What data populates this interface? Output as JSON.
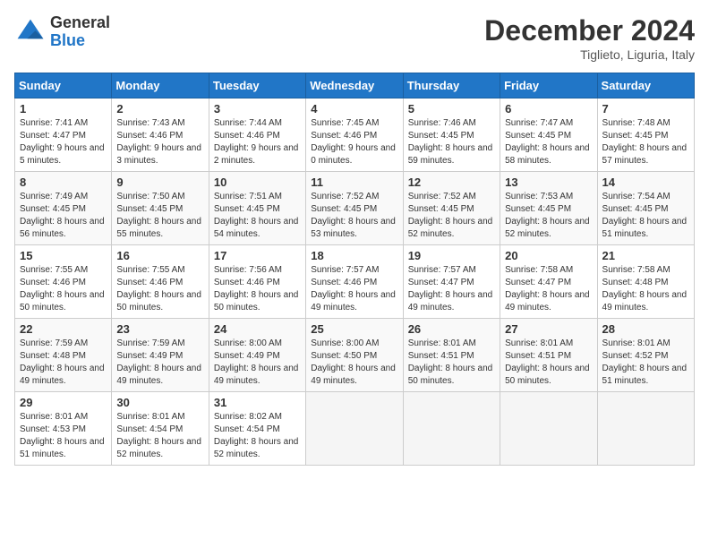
{
  "header": {
    "logo_general": "General",
    "logo_blue": "Blue",
    "month_title": "December 2024",
    "location": "Tiglieto, Liguria, Italy"
  },
  "days_of_week": [
    "Sunday",
    "Monday",
    "Tuesday",
    "Wednesday",
    "Thursday",
    "Friday",
    "Saturday"
  ],
  "weeks": [
    [
      {
        "day": "1",
        "sunrise": "7:41 AM",
        "sunset": "4:47 PM",
        "daylight": "9 hours and 5 minutes."
      },
      {
        "day": "2",
        "sunrise": "7:43 AM",
        "sunset": "4:46 PM",
        "daylight": "9 hours and 3 minutes."
      },
      {
        "day": "3",
        "sunrise": "7:44 AM",
        "sunset": "4:46 PM",
        "daylight": "9 hours and 2 minutes."
      },
      {
        "day": "4",
        "sunrise": "7:45 AM",
        "sunset": "4:46 PM",
        "daylight": "9 hours and 0 minutes."
      },
      {
        "day": "5",
        "sunrise": "7:46 AM",
        "sunset": "4:45 PM",
        "daylight": "8 hours and 59 minutes."
      },
      {
        "day": "6",
        "sunrise": "7:47 AM",
        "sunset": "4:45 PM",
        "daylight": "8 hours and 58 minutes."
      },
      {
        "day": "7",
        "sunrise": "7:48 AM",
        "sunset": "4:45 PM",
        "daylight": "8 hours and 57 minutes."
      }
    ],
    [
      {
        "day": "8",
        "sunrise": "7:49 AM",
        "sunset": "4:45 PM",
        "daylight": "8 hours and 56 minutes."
      },
      {
        "day": "9",
        "sunrise": "7:50 AM",
        "sunset": "4:45 PM",
        "daylight": "8 hours and 55 minutes."
      },
      {
        "day": "10",
        "sunrise": "7:51 AM",
        "sunset": "4:45 PM",
        "daylight": "8 hours and 54 minutes."
      },
      {
        "day": "11",
        "sunrise": "7:52 AM",
        "sunset": "4:45 PM",
        "daylight": "8 hours and 53 minutes."
      },
      {
        "day": "12",
        "sunrise": "7:52 AM",
        "sunset": "4:45 PM",
        "daylight": "8 hours and 52 minutes."
      },
      {
        "day": "13",
        "sunrise": "7:53 AM",
        "sunset": "4:45 PM",
        "daylight": "8 hours and 52 minutes."
      },
      {
        "day": "14",
        "sunrise": "7:54 AM",
        "sunset": "4:45 PM",
        "daylight": "8 hours and 51 minutes."
      }
    ],
    [
      {
        "day": "15",
        "sunrise": "7:55 AM",
        "sunset": "4:46 PM",
        "daylight": "8 hours and 50 minutes."
      },
      {
        "day": "16",
        "sunrise": "7:55 AM",
        "sunset": "4:46 PM",
        "daylight": "8 hours and 50 minutes."
      },
      {
        "day": "17",
        "sunrise": "7:56 AM",
        "sunset": "4:46 PM",
        "daylight": "8 hours and 50 minutes."
      },
      {
        "day": "18",
        "sunrise": "7:57 AM",
        "sunset": "4:46 PM",
        "daylight": "8 hours and 49 minutes."
      },
      {
        "day": "19",
        "sunrise": "7:57 AM",
        "sunset": "4:47 PM",
        "daylight": "8 hours and 49 minutes."
      },
      {
        "day": "20",
        "sunrise": "7:58 AM",
        "sunset": "4:47 PM",
        "daylight": "8 hours and 49 minutes."
      },
      {
        "day": "21",
        "sunrise": "7:58 AM",
        "sunset": "4:48 PM",
        "daylight": "8 hours and 49 minutes."
      }
    ],
    [
      {
        "day": "22",
        "sunrise": "7:59 AM",
        "sunset": "4:48 PM",
        "daylight": "8 hours and 49 minutes."
      },
      {
        "day": "23",
        "sunrise": "7:59 AM",
        "sunset": "4:49 PM",
        "daylight": "8 hours and 49 minutes."
      },
      {
        "day": "24",
        "sunrise": "8:00 AM",
        "sunset": "4:49 PM",
        "daylight": "8 hours and 49 minutes."
      },
      {
        "day": "25",
        "sunrise": "8:00 AM",
        "sunset": "4:50 PM",
        "daylight": "8 hours and 49 minutes."
      },
      {
        "day": "26",
        "sunrise": "8:01 AM",
        "sunset": "4:51 PM",
        "daylight": "8 hours and 50 minutes."
      },
      {
        "day": "27",
        "sunrise": "8:01 AM",
        "sunset": "4:51 PM",
        "daylight": "8 hours and 50 minutes."
      },
      {
        "day": "28",
        "sunrise": "8:01 AM",
        "sunset": "4:52 PM",
        "daylight": "8 hours and 51 minutes."
      }
    ],
    [
      {
        "day": "29",
        "sunrise": "8:01 AM",
        "sunset": "4:53 PM",
        "daylight": "8 hours and 51 minutes."
      },
      {
        "day": "30",
        "sunrise": "8:01 AM",
        "sunset": "4:54 PM",
        "daylight": "8 hours and 52 minutes."
      },
      {
        "day": "31",
        "sunrise": "8:02 AM",
        "sunset": "4:54 PM",
        "daylight": "8 hours and 52 minutes."
      },
      null,
      null,
      null,
      null
    ]
  ]
}
